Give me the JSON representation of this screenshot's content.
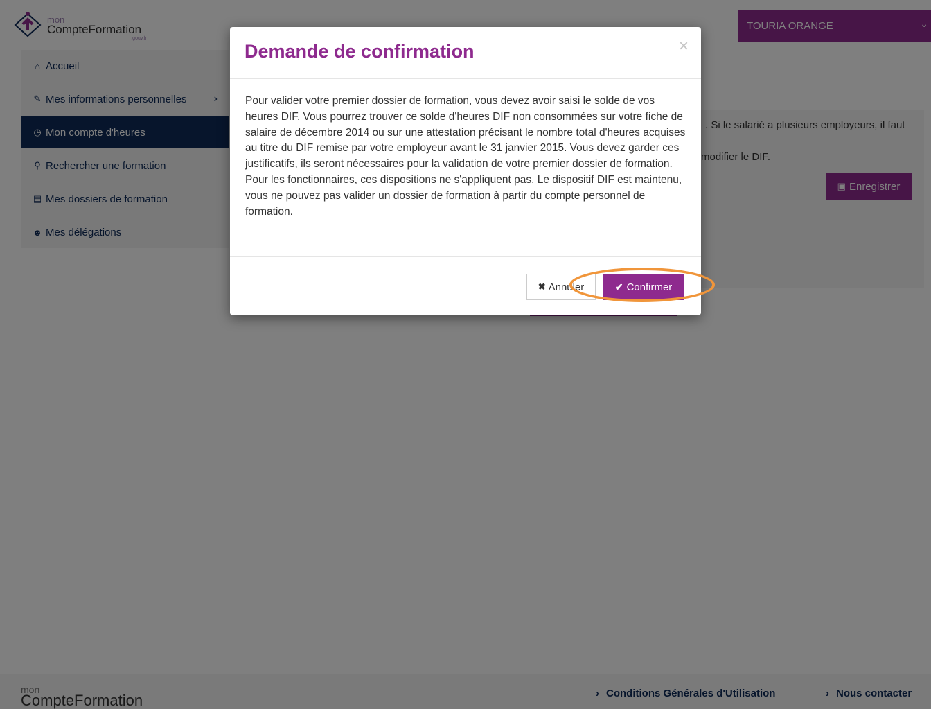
{
  "header": {
    "logo": {
      "mon": "mon",
      "name": "CompteFormation",
      "gouv": ".gouv.fr"
    },
    "user_name": "TOURIA ORANGE"
  },
  "sidebar": {
    "items": [
      {
        "label": "Accueil",
        "icon": "home-icon"
      },
      {
        "label": "Mes informations personnelles",
        "icon": "pencil-icon"
      },
      {
        "label": "Mon compte d'heures",
        "icon": "clock-icon"
      },
      {
        "label": "Rechercher une formation",
        "icon": "search-icon"
      },
      {
        "label": "Mes dossiers de formation",
        "icon": "book-icon"
      },
      {
        "label": "Mes délégations",
        "icon": "users-icon"
      }
    ],
    "active_index": 2
  },
  "main": {
    "text_line1": ". Si le salarié a plusieurs employeurs, il faut",
    "text_line2": "modifier le DIF.",
    "save_label": "Enregistrer"
  },
  "modal": {
    "title": "Demande de confirmation",
    "close_glyph": "×",
    "paragraph1": "Pour valider votre premier dossier de formation, vous devez avoir saisi le solde de vos heures DIF. Vous pourrez trouver ce solde d'heures DIF non consommées sur votre fiche de salaire de décembre 2014 ou sur une attestation précisant le nombre total d'heures acquises au titre du DIF remise par votre employeur avant le 31 janvier 2015. Vous devez garder ces justificatifs, ils seront nécessaires pour la validation de votre premier dossier de formation.",
    "paragraph2": "Pour les fonctionnaires, ces dispositions ne s'appliquent pas. Le dispositif DIF est maintenu, vous ne pouvez pas valider un dossier de formation à partir du compte personnel de formation.",
    "cancel_label": "Annuler",
    "confirm_label": "Confirmer"
  },
  "footer": {
    "logo": {
      "mon": "mon",
      "name": "CompteFormation"
    },
    "links": [
      "Conditions Générales d'Utilisation",
      "Nous contacter"
    ]
  },
  "colors": {
    "brand_purple": "#8e2a8e",
    "navy": "#0e2b59",
    "highlight_orange": "#f0953a"
  }
}
